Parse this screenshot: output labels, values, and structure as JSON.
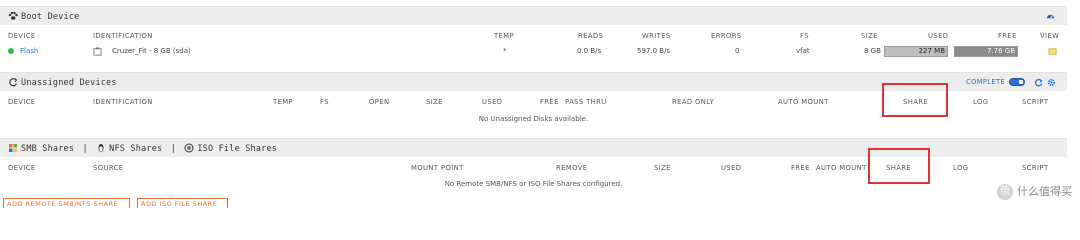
{
  "boot": {
    "title": "Boot Device",
    "columns": [
      "DEVICE",
      "IDENTIFICATION",
      "TEMP",
      "READS",
      "WRITES",
      "ERRORS",
      "FS",
      "SIZE",
      "USED",
      "FREE",
      "VIEW"
    ],
    "row": {
      "device": "Flash",
      "identification": "Cruzer_Fit - 8 GB (sda)",
      "temp": "*",
      "reads": "0.0 B/s",
      "writes": "597.0 B/s",
      "errors": "0",
      "fs": "vfat",
      "size": "8 GB",
      "used": "227 MB",
      "free": "7.76 GB"
    }
  },
  "unassigned": {
    "title": "Unassigned Devices",
    "complete_label": "COMPLETE",
    "columns": [
      "DEVICE",
      "IDENTIFICATION",
      "TEMP",
      "FS",
      "OPEN",
      "SIZE",
      "USED",
      "FREE",
      "PASS THRU",
      "READ ONLY",
      "AUTO MOUNT",
      "SHARE",
      "LOG",
      "SCRIPT"
    ],
    "empty": "No Unassigned Disks available."
  },
  "shares": {
    "smb_title": "SMB Shares",
    "nfs_title": "NFS Shares",
    "iso_title": "ISO File Shares",
    "separator": "|",
    "columns": [
      "DEVICE",
      "SOURCE",
      "MOUNT POINT",
      "REMOVE",
      "SIZE",
      "USED",
      "FREE",
      "AUTO MOUNT",
      "SHARE",
      "LOG",
      "SCRIPT"
    ],
    "empty": "No Remote SMB/NFS or ISO File Shares configured.",
    "add_remote_button": "ADD REMOTE SMB/NFS SHARE",
    "add_iso_button": "ADD ISO FILE SHARE"
  },
  "watermark": {
    "text": "什么值得买",
    "glyph": "值"
  },
  "colors": {
    "highlight": "#d9353a",
    "accent": "#2f6fcf",
    "button": "#e8713a",
    "status_green": "#3cb043"
  }
}
